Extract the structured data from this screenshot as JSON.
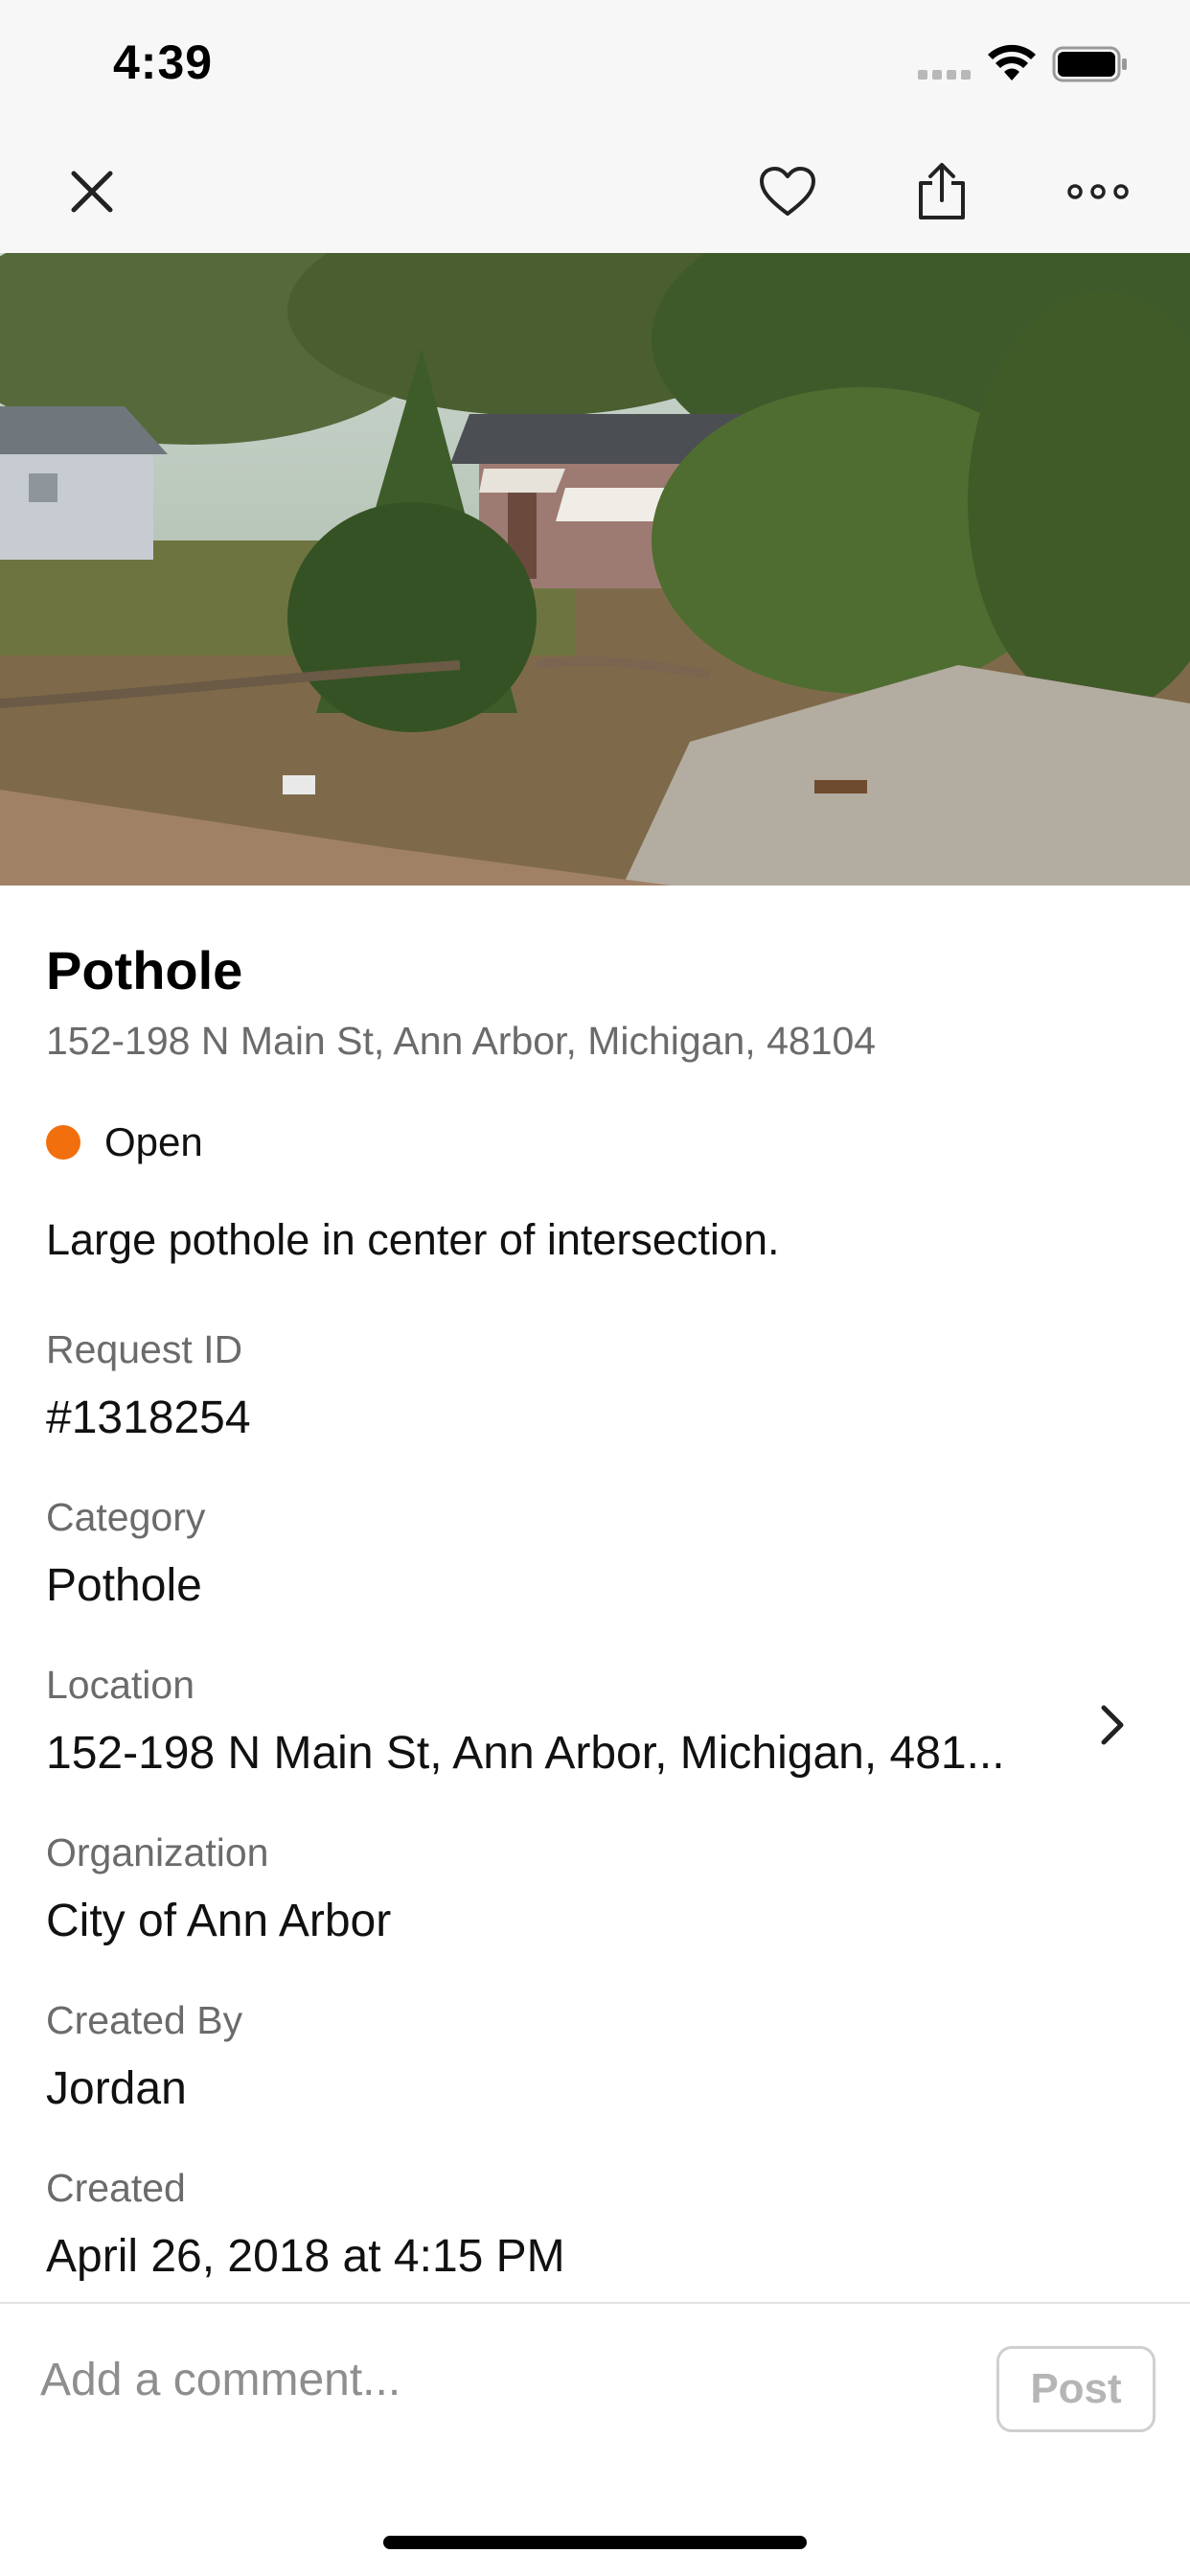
{
  "status_bar": {
    "time": "4:39"
  },
  "nav": {
    "close_icon": "close-icon",
    "favorite_icon": "heart-icon",
    "share_icon": "share-icon",
    "more_icon": "more-horizontal-icon"
  },
  "request": {
    "title": "Pothole",
    "address": "152-198 N Main St, Ann Arbor, Michigan, 48104",
    "status": "Open",
    "status_color": "#f26f0d",
    "description": "Large pothole in center of intersection."
  },
  "details": {
    "request_id_label": "Request ID",
    "request_id_value": "#1318254",
    "category_label": "Category",
    "category_value": "Pothole",
    "location_label": "Location",
    "location_value": "152-198 N Main St, Ann Arbor, Michigan, 481...",
    "organization_label": "Organization",
    "organization_value": "City of Ann Arbor",
    "created_by_label": "Created By",
    "created_by_value": "Jordan",
    "created_label": "Created",
    "created_value": "April 26, 2018 at 4:15 PM"
  },
  "comment": {
    "placeholder": "Add a comment...",
    "post_label": "Post"
  }
}
